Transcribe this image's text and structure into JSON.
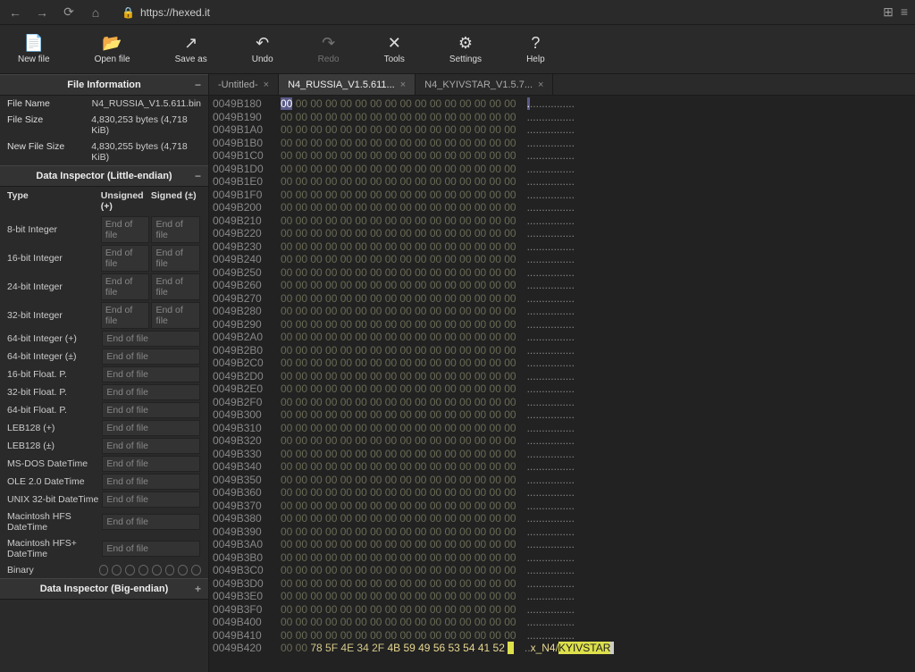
{
  "browser": {
    "url": "https://hexed.it"
  },
  "toolbar": {
    "new_file": "New file",
    "open_file": "Open file",
    "save_as": "Save as",
    "undo": "Undo",
    "redo": "Redo",
    "tools": "Tools",
    "settings": "Settings",
    "help": "Help"
  },
  "panels": {
    "file_info_title": "File Information",
    "data_inspector_le_title": "Data Inspector (Little-endian)",
    "data_inspector_be_title": "Data Inspector (Big-endian)"
  },
  "file_info": {
    "name_label": "File Name",
    "name_value": "N4_RUSSIA_V1.5.611.bin",
    "size_label": "File Size",
    "size_value": "4,830,253 bytes (4,718 KiB)",
    "newsize_label": "New File Size",
    "newsize_value": "4,830,255 bytes (4,718 KiB)"
  },
  "inspector_headers": {
    "type": "Type",
    "unsigned": "Unsigned (+)",
    "signed": "Signed (±)"
  },
  "eof": "End of file",
  "inspector_types": {
    "i8": "8-bit Integer",
    "i16": "16-bit Integer",
    "i24": "24-bit Integer",
    "i32": "32-bit Integer",
    "i64u": "64-bit Integer (+)",
    "i64s": "64-bit Integer (±)",
    "f16": "16-bit Float. P.",
    "f32": "32-bit Float. P.",
    "f64": "64-bit Float. P.",
    "leb128u": "LEB128 (+)",
    "leb128s": "LEB128 (±)",
    "msdos": "MS-DOS DateTime",
    "ole2": "OLE 2.0 DateTime",
    "unix32": "UNIX 32-bit DateTime",
    "machfs": "Macintosh HFS DateTime",
    "machfsplus": "Macintosh HFS+ DateTime",
    "binary": "Binary"
  },
  "tabs": [
    {
      "label": "-Untitled-",
      "active": false
    },
    {
      "label": "N4_RUSSIA_V1.5.611...",
      "active": true
    },
    {
      "label": "N4_KYIVSTAR_V1.5.7...",
      "active": false
    }
  ],
  "hex": {
    "start_offset": "0049B180",
    "offsets": [
      "0049B180",
      "0049B190",
      "0049B1A0",
      "0049B1B0",
      "0049B1C0",
      "0049B1D0",
      "0049B1E0",
      "0049B1F0",
      "0049B200",
      "0049B210",
      "0049B220",
      "0049B230",
      "0049B240",
      "0049B250",
      "0049B260",
      "0049B270",
      "0049B280",
      "0049B290",
      "0049B2A0",
      "0049B2B0",
      "0049B2C0",
      "0049B2D0",
      "0049B2E0",
      "0049B2F0",
      "0049B300",
      "0049B310",
      "0049B320",
      "0049B330",
      "0049B340",
      "0049B350",
      "0049B360",
      "0049B370",
      "0049B380",
      "0049B390",
      "0049B3A0",
      "0049B3B0",
      "0049B3C0",
      "0049B3D0",
      "0049B3E0",
      "0049B3F0",
      "0049B400",
      "0049B410",
      "0049B420"
    ],
    "zero_bytes": "00 00 00 00 00 00 00 00 00 00 00 00 00 00 00 00",
    "zero_ascii": "................",
    "last_line": {
      "pre": "00 00 ",
      "mid": "78 5F 4E 34 2F ",
      "sel": "4B 59 49 56 53 54 41 52 ",
      "cursor": "  ",
      "ascii_pre": "..",
      "ascii_mid": "x_N4/",
      "ascii_sel": "KYIVSTAR"
    }
  }
}
